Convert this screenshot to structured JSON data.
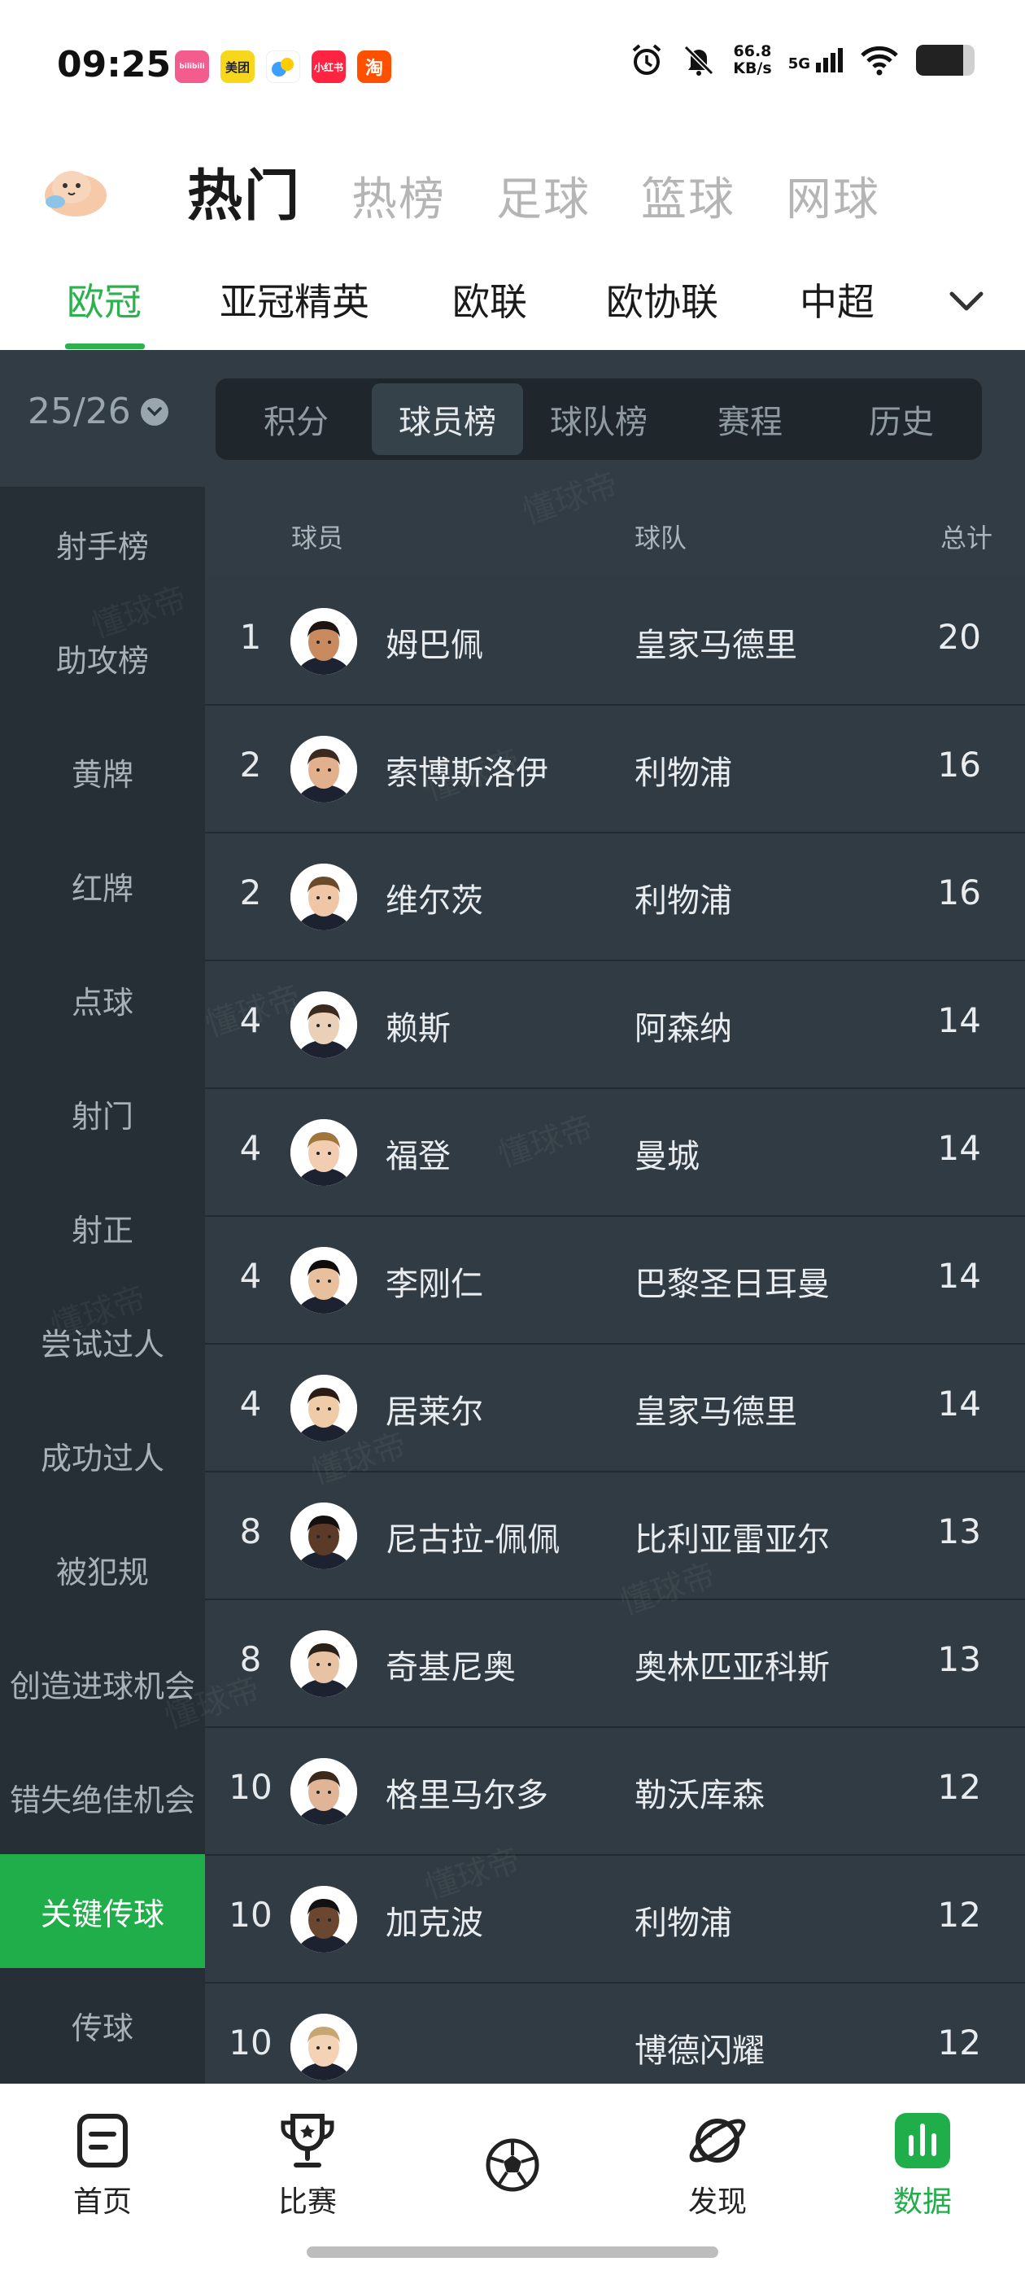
{
  "status_bar": {
    "time": "09:25",
    "apps": [
      {
        "label": "bilibili",
        "color": "#f25d8e"
      },
      {
        "label": "美团",
        "color": "#f7d71e"
      },
      {
        "label": "",
        "color": "#3ba0ff"
      },
      {
        "label": "小红书",
        "color": "#ff2442"
      },
      {
        "label": "淘",
        "color": "#ff5000"
      }
    ],
    "speed_value": "66.8",
    "speed_unit": "KB/s",
    "network": "5G"
  },
  "top_nav": {
    "tabs": [
      {
        "label": "热门",
        "active": true
      },
      {
        "label": "热榜"
      },
      {
        "label": "足球"
      },
      {
        "label": "篮球"
      },
      {
        "label": "网球"
      }
    ]
  },
  "league_tabs": [
    {
      "label": "欧冠",
      "active": true
    },
    {
      "label": "亚冠精英"
    },
    {
      "label": "欧联"
    },
    {
      "label": "欧协联"
    },
    {
      "label": "中超"
    }
  ],
  "filter": {
    "season": "25/26",
    "segments": [
      {
        "label": "积分"
      },
      {
        "label": "球员榜",
        "active": true
      },
      {
        "label": "球队榜"
      },
      {
        "label": "赛程"
      },
      {
        "label": "历史"
      }
    ]
  },
  "sidebar": [
    {
      "label": "射手榜"
    },
    {
      "label": "助攻榜"
    },
    {
      "label": "黄牌"
    },
    {
      "label": "红牌"
    },
    {
      "label": "点球"
    },
    {
      "label": "射门"
    },
    {
      "label": "射正"
    },
    {
      "label": "尝试过人"
    },
    {
      "label": "成功过人"
    },
    {
      "label": "被犯规"
    },
    {
      "label": "创造进球机会"
    },
    {
      "label": "错失绝佳机会"
    },
    {
      "label": "关键传球",
      "active": true
    },
    {
      "label": "传球"
    }
  ],
  "table": {
    "headers": {
      "player": "球员",
      "team": "球队",
      "total": "总计"
    },
    "rows": [
      {
        "rank": "1",
        "name": "姆巴佩",
        "team": "皇家马德里",
        "total": "20"
      },
      {
        "rank": "2",
        "name": "索博斯洛伊",
        "team": "利物浦",
        "total": "16"
      },
      {
        "rank": "2",
        "name": "维尔茨",
        "team": "利物浦",
        "total": "16"
      },
      {
        "rank": "4",
        "name": "赖斯",
        "team": "阿森纳",
        "total": "14"
      },
      {
        "rank": "4",
        "name": "福登",
        "team": "曼城",
        "total": "14"
      },
      {
        "rank": "4",
        "name": "李刚仁",
        "team": "巴黎圣日耳曼",
        "total": "14"
      },
      {
        "rank": "4",
        "name": "居莱尔",
        "team": "皇家马德里",
        "total": "14"
      },
      {
        "rank": "8",
        "name": "尼古拉-佩佩",
        "team": "比利亚雷亚尔",
        "total": "13"
      },
      {
        "rank": "8",
        "name": "奇基尼奥",
        "team": "奥林匹亚科斯",
        "total": "13"
      },
      {
        "rank": "10",
        "name": "格里马尔多",
        "team": "勒沃库森",
        "total": "12"
      },
      {
        "rank": "10",
        "name": "加克波",
        "team": "利物浦",
        "total": "12"
      },
      {
        "rank": "10",
        "name": "",
        "team": "博德闪耀",
        "total": "12"
      }
    ]
  },
  "watermark": "懂球帝",
  "bottom_nav": [
    {
      "label": "首页",
      "icon": "home-icon"
    },
    {
      "label": "比赛",
      "icon": "trophy-icon"
    },
    {
      "label": "",
      "icon": "football-icon"
    },
    {
      "label": "发现",
      "icon": "planet-icon"
    },
    {
      "label": "数据",
      "icon": "chart-icon",
      "active": true
    }
  ],
  "colors": {
    "accent": "#1fae49",
    "dark_bg": "#2a343c"
  }
}
